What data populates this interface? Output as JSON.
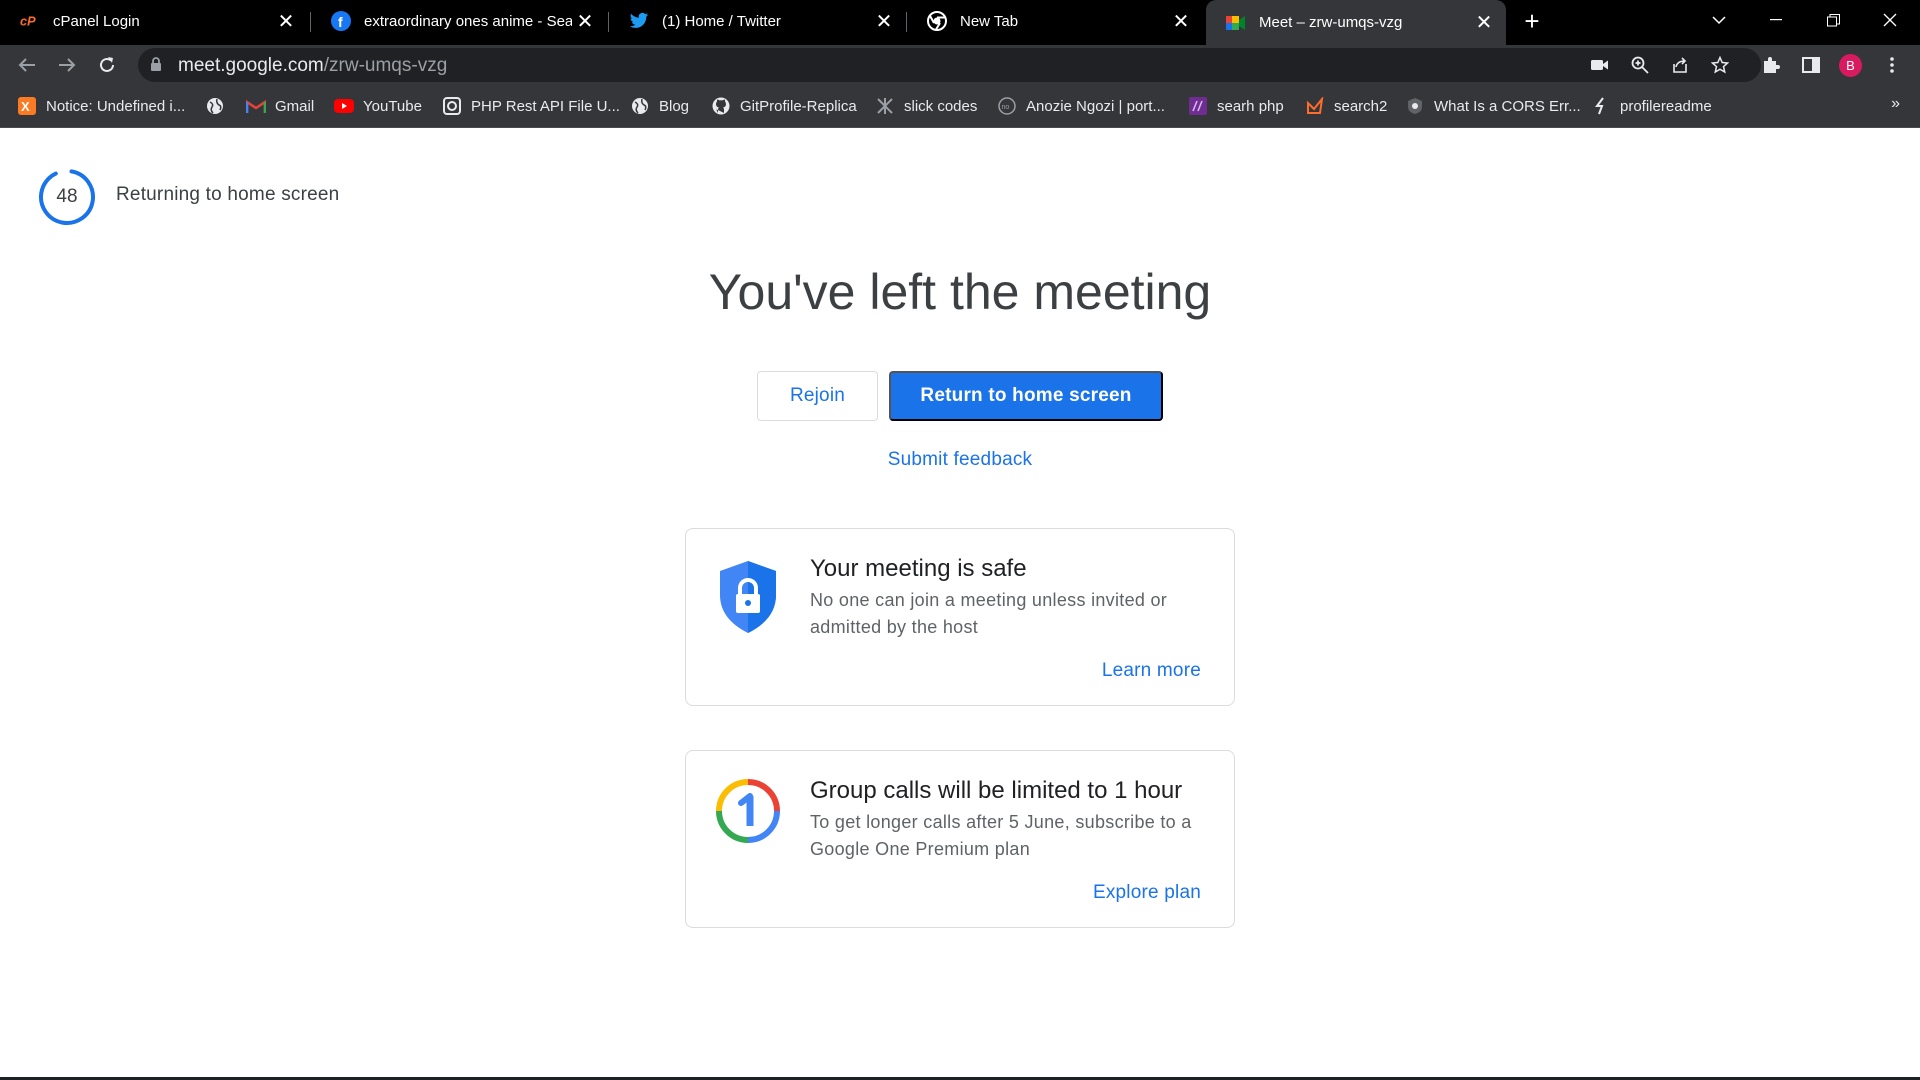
{
  "browser": {
    "tabs": [
      {
        "title": "cPanel Login",
        "icon": "cpanel-icon",
        "active": false
      },
      {
        "title": "extraordinary ones anime - Searc",
        "icon": "facebook-icon",
        "active": false
      },
      {
        "title": "(1) Home / Twitter",
        "icon": "twitter-icon",
        "active": false
      },
      {
        "title": "New Tab",
        "icon": "chrome-icon",
        "active": false
      },
      {
        "title": "Meet – zrw-umqs-vzg",
        "icon": "google-meet-icon",
        "active": true
      }
    ],
    "address": {
      "host": "meet.google.com",
      "path": "/zrw-umqs-vzg"
    },
    "profile_initial": "B",
    "bookmarks": [
      {
        "label": "Notice: Undefined i...",
        "icon": "xampp-icon"
      },
      {
        "label": "",
        "icon": "globe-icon"
      },
      {
        "label": "Gmail",
        "icon": "gmail-icon"
      },
      {
        "label": "YouTube",
        "icon": "youtube-icon"
      },
      {
        "label": "PHP Rest API File U...",
        "icon": "page-icon"
      },
      {
        "label": "Blog",
        "icon": "globe-icon"
      },
      {
        "label": "GitProfile-Replica",
        "icon": "github-icon"
      },
      {
        "label": "slick codes",
        "icon": "slick-icon"
      },
      {
        "label": "Anozie Ngozi | port...",
        "icon": "portfolio-icon"
      },
      {
        "label": "searh php",
        "icon": "php-icon"
      },
      {
        "label": "search2",
        "icon": "search2-icon"
      },
      {
        "label": "What Is a CORS Err...",
        "icon": "cors-icon"
      },
      {
        "label": "profilereadme",
        "icon": "profile-icon"
      }
    ],
    "more_bookmarks": "»"
  },
  "page": {
    "countdown": 48,
    "countdown_label": "Returning to home screen",
    "headline": "You've left the meeting",
    "rejoin_label": "Rejoin",
    "return_label": "Return to home screen",
    "feedback_label": "Submit feedback",
    "cards": [
      {
        "icon": "shield-lock-icon",
        "title": "Your meeting is safe",
        "description": "No one can join a meeting unless invited or admitted by the host",
        "link": "Learn more"
      },
      {
        "icon": "google-one-icon",
        "title": "Group calls will be limited to 1 hour",
        "description": "To get longer calls after 5 June, subscribe to a Google One Premium plan",
        "link": "Explore plan"
      }
    ]
  },
  "colors": {
    "accent": "#1a73e8",
    "chrome_bg": "#35363a",
    "tabstrip_bg": "#000000",
    "avatar": "#d81b60"
  }
}
